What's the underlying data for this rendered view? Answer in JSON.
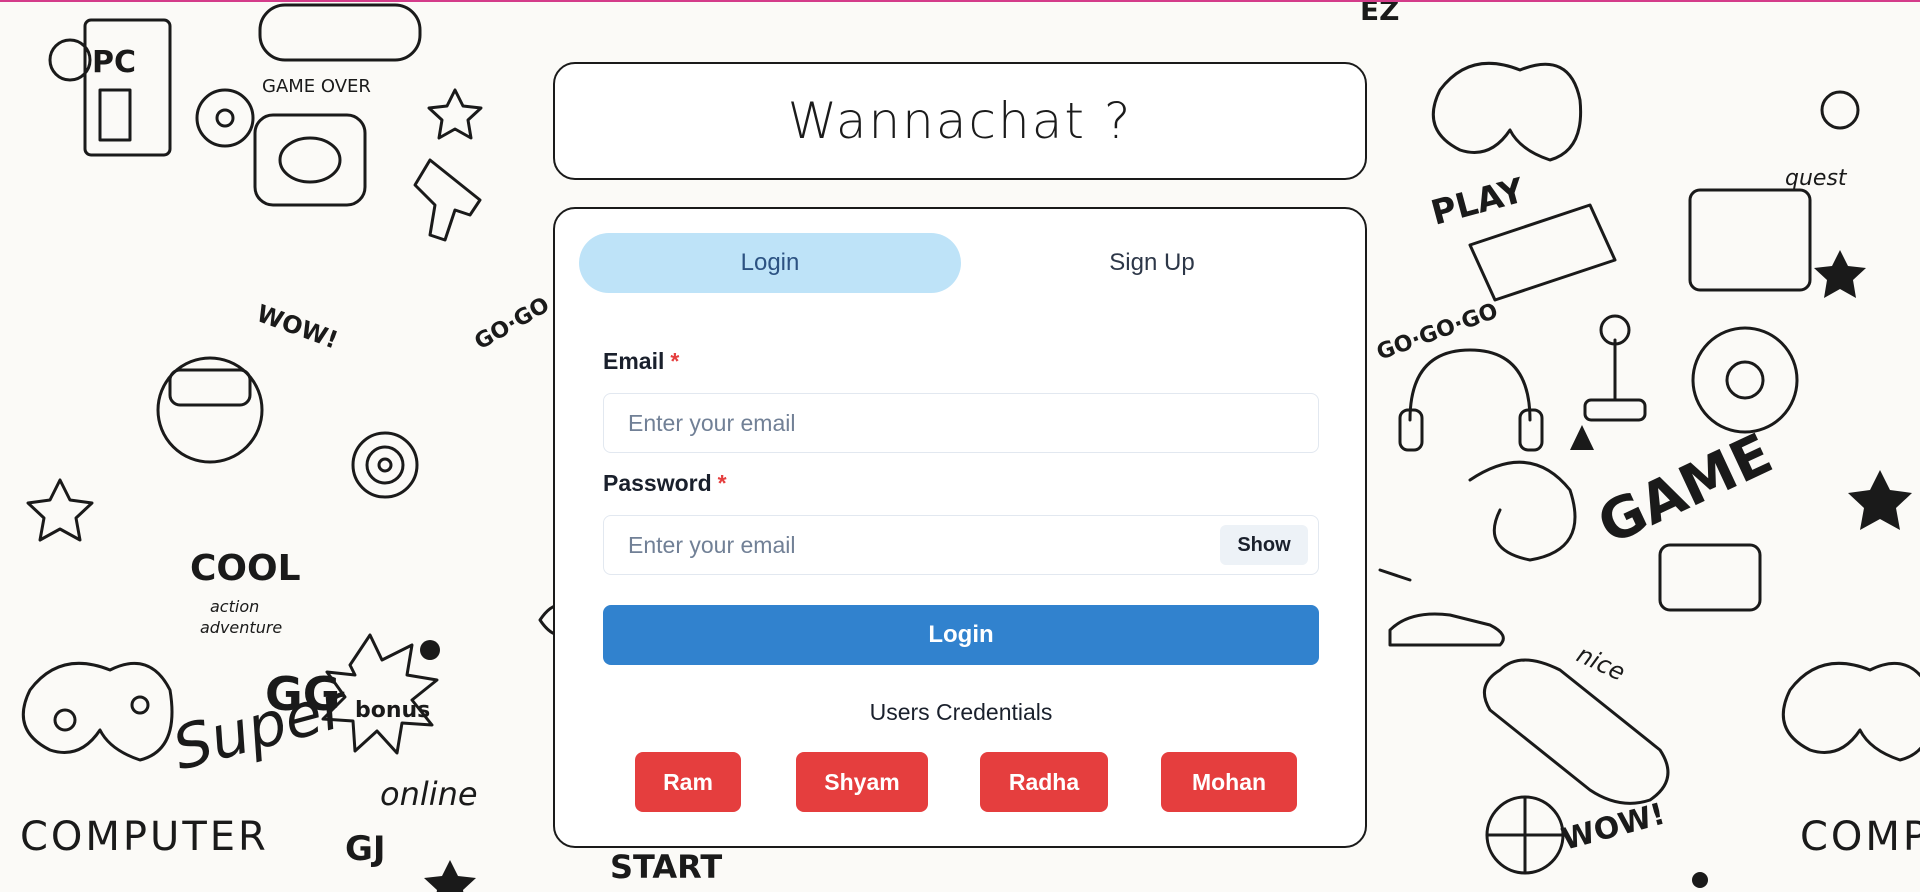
{
  "app": {
    "title": "Wannachat ?"
  },
  "tabs": [
    {
      "label": "Login",
      "active": true
    },
    {
      "label": "Sign Up",
      "active": false
    }
  ],
  "form": {
    "email_label": "Email",
    "email_placeholder": "Enter your email",
    "password_label": "Password",
    "password_placeholder": "Enter your email",
    "required_mark": "*",
    "show_label": "Show",
    "submit_label": "Login"
  },
  "credentials": {
    "title": "Users Credentials",
    "users": [
      "Ram",
      "Shyam",
      "Radha",
      "Mohan"
    ]
  },
  "colors": {
    "tab_active_bg": "#bee3f8",
    "primary": "#3182ce",
    "danger": "#e53e3e"
  }
}
